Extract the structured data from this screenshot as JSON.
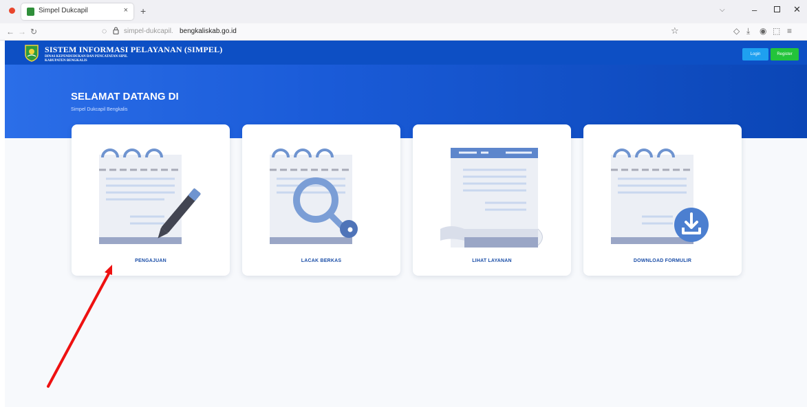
{
  "browser": {
    "tab_title": "Simpel Dukcapil",
    "tab_close": "×",
    "new_tab": "+",
    "url_prefix": "simpel-dukcapil.",
    "url_domain": "bengkaliskab.go.id"
  },
  "header": {
    "title": "SISTEM INFORMASI PELAYANAN (SIMPEL)",
    "subtitle_line1": "DINAS KEPENDUDUKAN DAN PENCATATAN SIPIL",
    "subtitle_line2": "KABUPATEN BENGKALIS",
    "login_label": "Login",
    "register_label": "Register"
  },
  "hero": {
    "title": "SELAMAT DATANG DI",
    "subtitle": "Simpel Dukcapil Bengkalis"
  },
  "cards": [
    {
      "label": "PENGAJUAN",
      "icon": "notepad-pen-icon"
    },
    {
      "label": "LACAK BERKAS",
      "icon": "notepad-magnifier-icon"
    },
    {
      "label": "LIHAT LAYANAN",
      "icon": "document-scroll-icon"
    },
    {
      "label": "DOWNLOAD FORMULIR",
      "icon": "notepad-download-icon"
    }
  ],
  "colors": {
    "header_blue": "#0d4fc4",
    "card_label": "#1c4fa8",
    "login_button": "#1ea0f0",
    "register_button": "#23c43a",
    "annotation_arrow": "#ee1111"
  }
}
